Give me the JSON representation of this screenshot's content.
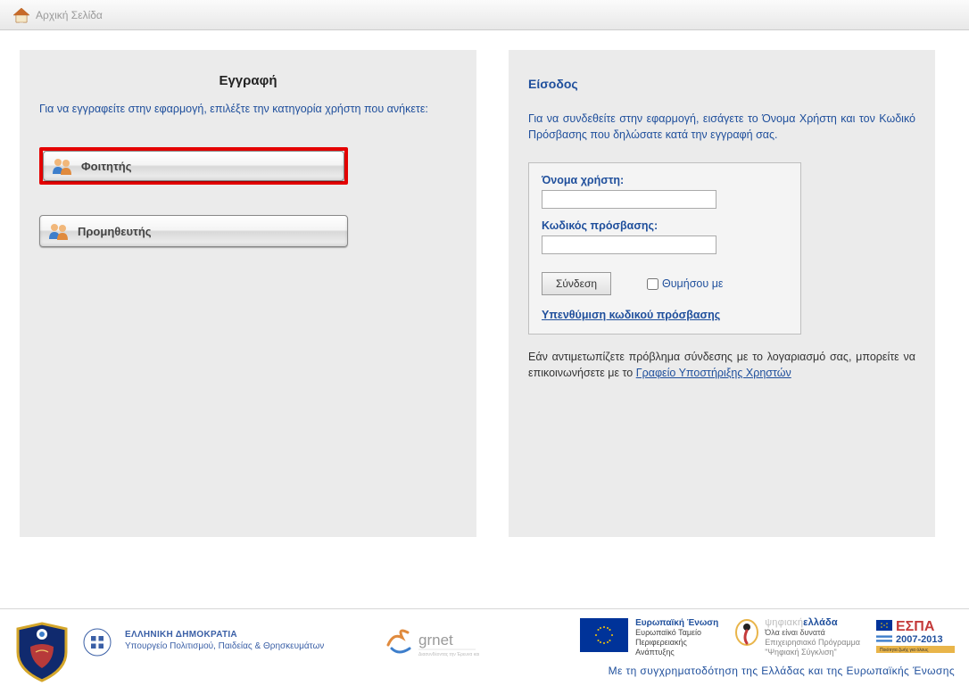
{
  "topbar": {
    "home_label": "Αρχική Σελίδα"
  },
  "registration": {
    "title": "Εγγραφή",
    "subtitle": "Για να εγγραφείτε στην εφαρμογή, επιλέξτε την κατηγορία χρήστη που ανήκετε:",
    "roles": [
      {
        "label": "Φοιτητής"
      },
      {
        "label": "Προμηθευτής"
      }
    ]
  },
  "login": {
    "title": "Είσοδος",
    "subtitle": "Για να συνδεθείτε στην εφαρμογή, εισάγετε το Όνομα Χρήστη και τον Κωδικό Πρόσβασης που δηλώσατε κατά την εγγραφή σας.",
    "username_label": "Όνομα χρήστη:",
    "password_label": "Κωδικός πρόσβασης:",
    "connect_label": "Σύνδεση",
    "remember_label": "Θυμήσου με",
    "forgot_label": "Υπενθύμιση κωδικού πρόσβασης",
    "problem_text_pre": "Εάν αντιμετωπίζετε πρόβλημα σύνδεσης με το λογαριασμό σας, μπορείτε να επικοινωνήσετε με το ",
    "problem_link": "Γραφείο Υποστήριξης Χρηστών"
  },
  "footer": {
    "gov_line1": "ΕΛΛΗΝΙΚΗ ΔΗΜΟΚΡΑΤΙΑ",
    "gov_line2": "Υπουργείο Πολιτισμού, Παιδείας & Θρησκευμάτων",
    "grnet_label": "grnet",
    "eu_title": "Ευρωπαϊκή Ένωση",
    "eu_sub1": "Ευρωπαϊκό Ταμείο",
    "eu_sub2": "Περιφερειακής",
    "eu_sub3": "Ανάπτυξης",
    "digital_title_a": "ψηφιακή",
    "digital_title_b": "ελλάδα",
    "digital_sub1": "Όλα είναι δυνατά",
    "digital_sub2": "Επιχειρησιακό Πρόγραμμα",
    "digital_sub3": "\"Ψηφιακή Σύγκλιση\"",
    "espa_label": "ΕΣΠΑ",
    "espa_years": "2007-2013",
    "bottom_line": "Με τη συγχρηματοδότηση της Ελλάδας και της Ευρωπαϊκής Ένωσης"
  }
}
